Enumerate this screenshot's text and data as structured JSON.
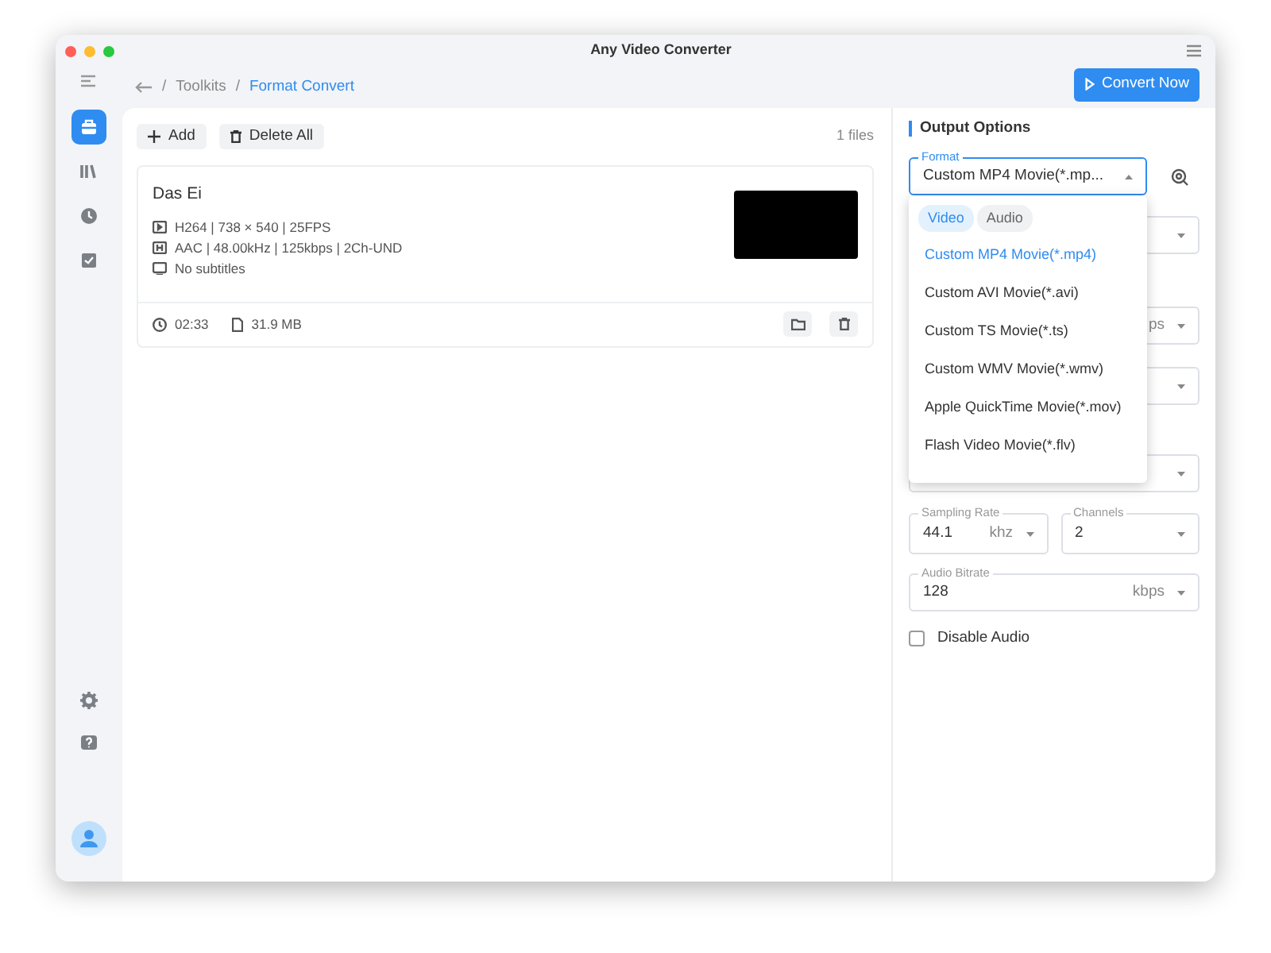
{
  "window": {
    "title": "Any Video Converter"
  },
  "sidebar": {
    "items": [
      {
        "kind": "toolbox",
        "selected": true
      },
      {
        "kind": "library",
        "selected": false
      },
      {
        "kind": "history",
        "selected": false
      },
      {
        "kind": "tasks",
        "selected": false
      }
    ]
  },
  "breadcrumb": [
    {
      "separator": "/",
      "label": "Toolkits",
      "current": false
    },
    {
      "separator": "/",
      "label": "Format Convert",
      "current": true
    }
  ],
  "convert_button": "Convert Now",
  "toolbar": {
    "add": "Add",
    "delete_all": "Delete All",
    "file_count": "1 files"
  },
  "files": [
    {
      "name": "Das Ei",
      "video": "H264 | 738 × 540 | 25FPS",
      "audio": "AAC | 48.00kHz | 125kbps | 2Ch-UND",
      "subtitles": "No subtitles",
      "duration": "02:33",
      "size": "31.9 MB"
    }
  ],
  "output_options": {
    "title": "Output Options",
    "format": {
      "label": "Format",
      "value": "Custom MP4 Movie(*.mp...",
      "expanded": true
    },
    "covered_fields": [
      {
        "kind": "select"
      },
      {
        "kind": "unit_select",
        "unit": "ps"
      },
      {
        "kind": "select"
      },
      {
        "kind": "select"
      }
    ],
    "sampling_rate": {
      "label": "Sampling Rate",
      "value": "44.1",
      "unit": "khz"
    },
    "channels": {
      "label": "Channels",
      "value": "2"
    },
    "audio_bitrate": {
      "label": "Audio Bitrate",
      "value": "128",
      "unit": "kbps"
    },
    "disable_audio": {
      "label": "Disable Audio",
      "checked": false
    }
  },
  "format_menu": {
    "tabs": [
      {
        "label": "Video",
        "selected": true
      },
      {
        "label": "Audio",
        "selected": false
      }
    ],
    "items": [
      {
        "label": "Custom MP4 Movie(*.mp4)",
        "selected": true
      },
      {
        "label": "Custom AVI Movie(*.avi)",
        "selected": false
      },
      {
        "label": "Custom TS Movie(*.ts)",
        "selected": false
      },
      {
        "label": "Custom WMV Movie(*.wmv)",
        "selected": false
      },
      {
        "label": "Apple QuickTime Movie(*.mov)",
        "selected": false
      },
      {
        "label": "Flash Video Movie(*.flv)",
        "selected": false
      }
    ]
  }
}
